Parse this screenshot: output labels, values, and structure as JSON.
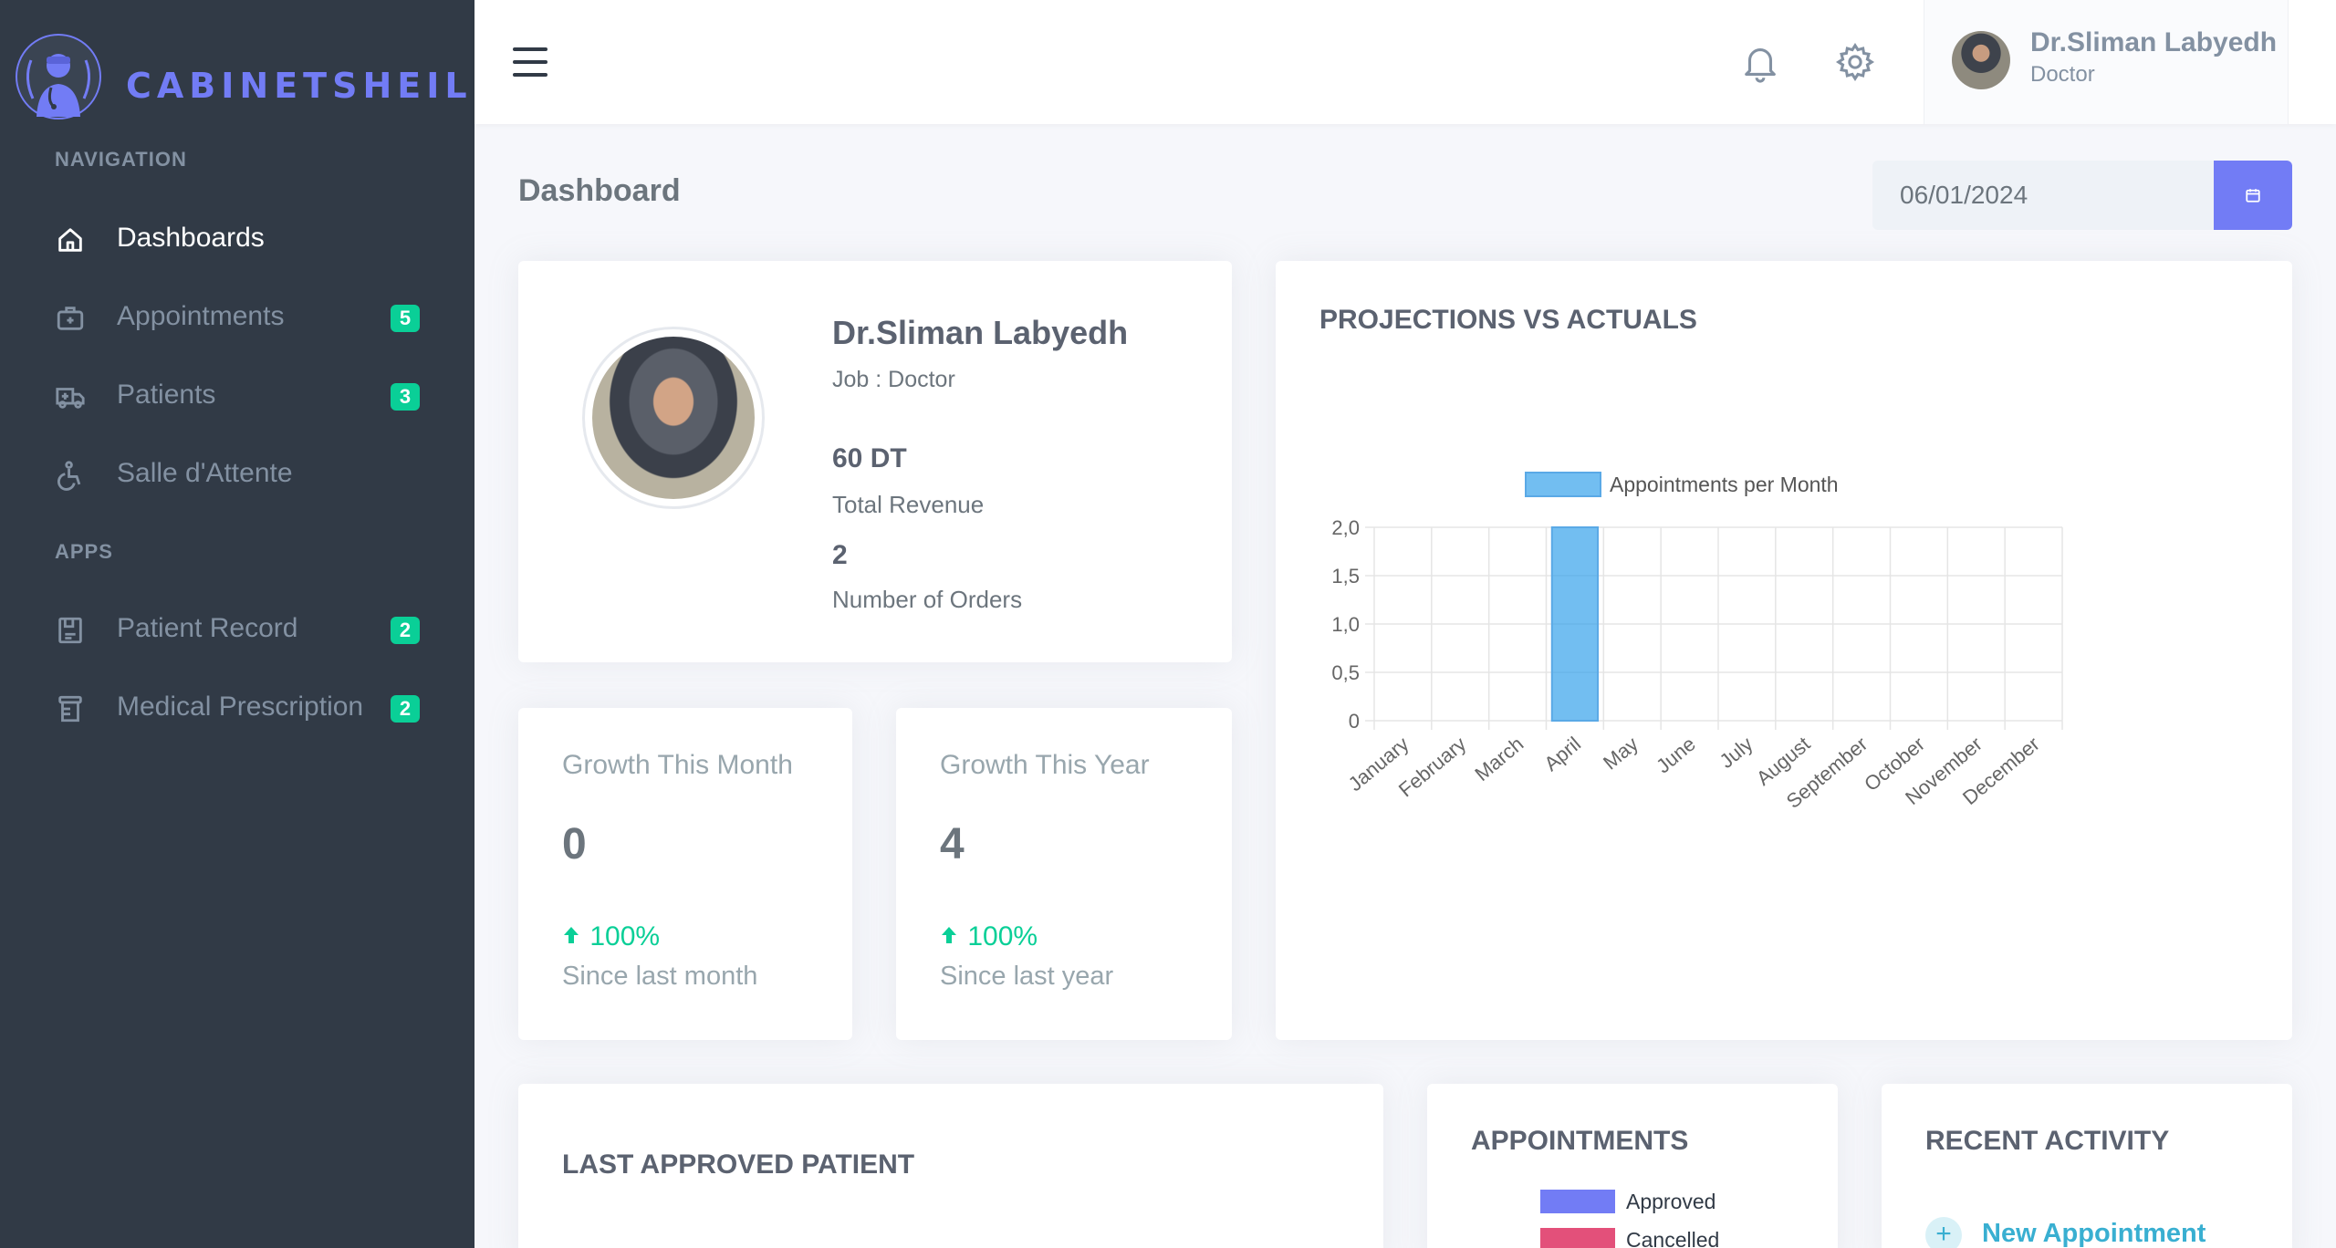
{
  "brand": {
    "name": "CABINETSHEILD"
  },
  "sidebar": {
    "sections": [
      {
        "title": "NAVIGATION"
      },
      {
        "title": "APPS"
      }
    ],
    "items": [
      {
        "label": "Dashboards",
        "icon": "home-icon",
        "badge": null,
        "active": true
      },
      {
        "label": "Appointments",
        "icon": "briefcase-medical-icon",
        "badge": "5"
      },
      {
        "label": "Patients",
        "icon": "ambulance-icon",
        "badge": "3"
      },
      {
        "label": "Salle d'Attente",
        "icon": "wheelchair-icon",
        "badge": null
      },
      {
        "label": "Patient Record",
        "icon": "record-icon",
        "badge": "2"
      },
      {
        "label": "Medical Prescription",
        "icon": "prescription-bottle-icon",
        "badge": "2"
      }
    ]
  },
  "topbar": {
    "user_name": "Dr.Sliman Labyedh",
    "user_role": "Doctor",
    "icons": [
      "hamburger-menu-icon",
      "bell-icon",
      "gear-icon"
    ]
  },
  "page": {
    "title": "Dashboard",
    "date_value": "06/01/2024"
  },
  "profile": {
    "name": "Dr.Sliman Labyedh",
    "job": "Job : Doctor",
    "revenue": "60 DT",
    "revenue_label": "Total Revenue",
    "orders": "2",
    "orders_label": "Number of Orders"
  },
  "growth": {
    "month": {
      "title": "Growth This Month",
      "value": "0",
      "percent": "100%",
      "since": "Since last month"
    },
    "year": {
      "title": "Growth This Year",
      "value": "4",
      "percent": "100%",
      "since": "Since last year"
    }
  },
  "projections": {
    "title": "PROJECTIONS VS ACTUALS"
  },
  "last_patient": {
    "title": "LAST APPROVED PATIENT"
  },
  "appointments": {
    "title": "APPOINTMENTS",
    "legend": [
      {
        "label": "Approved",
        "color": "#727cf5"
      },
      {
        "label": "Cancelled",
        "color": "#e3507a"
      }
    ]
  },
  "recent_activity": {
    "title": "RECENT ACTIVITY",
    "items": [
      {
        "label": "New Appointment"
      }
    ]
  },
  "colors": {
    "sidebar_bg": "#313a46",
    "accent": "#727cf5",
    "success": "#0acf97",
    "bar_fill": "#6cb8ec",
    "info": "#39afd1"
  },
  "chart_data": {
    "type": "bar",
    "categories": [
      "January",
      "February",
      "March",
      "April",
      "May",
      "June",
      "July",
      "August",
      "September",
      "October",
      "November",
      "December"
    ],
    "series": [
      {
        "name": "Appointments per Month",
        "values": [
          0,
          0,
          0,
          2,
          0,
          0,
          0,
          0,
          0,
          0,
          0,
          0
        ]
      }
    ],
    "y_ticks": [
      "0",
      "0,5",
      "1,0",
      "1,5",
      "2,0"
    ],
    "ylim": [
      0,
      2
    ],
    "grid": true,
    "legend_position": "top"
  }
}
